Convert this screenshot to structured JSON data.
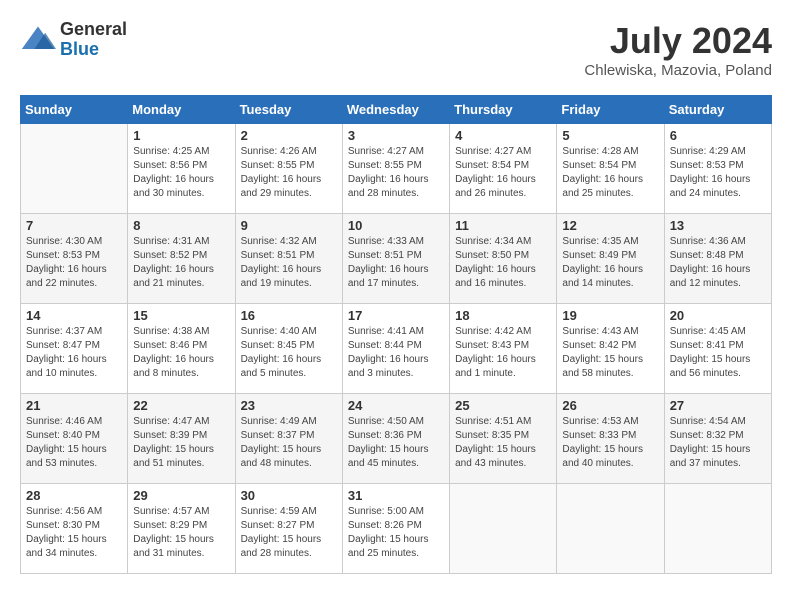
{
  "header": {
    "logo_general": "General",
    "logo_blue": "Blue",
    "month_year": "July 2024",
    "location": "Chlewiska, Mazovia, Poland"
  },
  "days_of_week": [
    "Sunday",
    "Monday",
    "Tuesday",
    "Wednesday",
    "Thursday",
    "Friday",
    "Saturday"
  ],
  "weeks": [
    [
      {
        "day": "",
        "sunrise": "",
        "sunset": "",
        "daylight": ""
      },
      {
        "day": "1",
        "sunrise": "4:25 AM",
        "sunset": "8:56 PM",
        "daylight": "16 hours and 30 minutes."
      },
      {
        "day": "2",
        "sunrise": "4:26 AM",
        "sunset": "8:55 PM",
        "daylight": "16 hours and 29 minutes."
      },
      {
        "day": "3",
        "sunrise": "4:27 AM",
        "sunset": "8:55 PM",
        "daylight": "16 hours and 28 minutes."
      },
      {
        "day": "4",
        "sunrise": "4:27 AM",
        "sunset": "8:54 PM",
        "daylight": "16 hours and 26 minutes."
      },
      {
        "day": "5",
        "sunrise": "4:28 AM",
        "sunset": "8:54 PM",
        "daylight": "16 hours and 25 minutes."
      },
      {
        "day": "6",
        "sunrise": "4:29 AM",
        "sunset": "8:53 PM",
        "daylight": "16 hours and 24 minutes."
      }
    ],
    [
      {
        "day": "7",
        "sunrise": "4:30 AM",
        "sunset": "8:53 PM",
        "daylight": "16 hours and 22 minutes."
      },
      {
        "day": "8",
        "sunrise": "4:31 AM",
        "sunset": "8:52 PM",
        "daylight": "16 hours and 21 minutes."
      },
      {
        "day": "9",
        "sunrise": "4:32 AM",
        "sunset": "8:51 PM",
        "daylight": "16 hours and 19 minutes."
      },
      {
        "day": "10",
        "sunrise": "4:33 AM",
        "sunset": "8:51 PM",
        "daylight": "16 hours and 17 minutes."
      },
      {
        "day": "11",
        "sunrise": "4:34 AM",
        "sunset": "8:50 PM",
        "daylight": "16 hours and 16 minutes."
      },
      {
        "day": "12",
        "sunrise": "4:35 AM",
        "sunset": "8:49 PM",
        "daylight": "16 hours and 14 minutes."
      },
      {
        "day": "13",
        "sunrise": "4:36 AM",
        "sunset": "8:48 PM",
        "daylight": "16 hours and 12 minutes."
      }
    ],
    [
      {
        "day": "14",
        "sunrise": "4:37 AM",
        "sunset": "8:47 PM",
        "daylight": "16 hours and 10 minutes."
      },
      {
        "day": "15",
        "sunrise": "4:38 AM",
        "sunset": "8:46 PM",
        "daylight": "16 hours and 8 minutes."
      },
      {
        "day": "16",
        "sunrise": "4:40 AM",
        "sunset": "8:45 PM",
        "daylight": "16 hours and 5 minutes."
      },
      {
        "day": "17",
        "sunrise": "4:41 AM",
        "sunset": "8:44 PM",
        "daylight": "16 hours and 3 minutes."
      },
      {
        "day": "18",
        "sunrise": "4:42 AM",
        "sunset": "8:43 PM",
        "daylight": "16 hours and 1 minute."
      },
      {
        "day": "19",
        "sunrise": "4:43 AM",
        "sunset": "8:42 PM",
        "daylight": "15 hours and 58 minutes."
      },
      {
        "day": "20",
        "sunrise": "4:45 AM",
        "sunset": "8:41 PM",
        "daylight": "15 hours and 56 minutes."
      }
    ],
    [
      {
        "day": "21",
        "sunrise": "4:46 AM",
        "sunset": "8:40 PM",
        "daylight": "15 hours and 53 minutes."
      },
      {
        "day": "22",
        "sunrise": "4:47 AM",
        "sunset": "8:39 PM",
        "daylight": "15 hours and 51 minutes."
      },
      {
        "day": "23",
        "sunrise": "4:49 AM",
        "sunset": "8:37 PM",
        "daylight": "15 hours and 48 minutes."
      },
      {
        "day": "24",
        "sunrise": "4:50 AM",
        "sunset": "8:36 PM",
        "daylight": "15 hours and 45 minutes."
      },
      {
        "day": "25",
        "sunrise": "4:51 AM",
        "sunset": "8:35 PM",
        "daylight": "15 hours and 43 minutes."
      },
      {
        "day": "26",
        "sunrise": "4:53 AM",
        "sunset": "8:33 PM",
        "daylight": "15 hours and 40 minutes."
      },
      {
        "day": "27",
        "sunrise": "4:54 AM",
        "sunset": "8:32 PM",
        "daylight": "15 hours and 37 minutes."
      }
    ],
    [
      {
        "day": "28",
        "sunrise": "4:56 AM",
        "sunset": "8:30 PM",
        "daylight": "15 hours and 34 minutes."
      },
      {
        "day": "29",
        "sunrise": "4:57 AM",
        "sunset": "8:29 PM",
        "daylight": "15 hours and 31 minutes."
      },
      {
        "day": "30",
        "sunrise": "4:59 AM",
        "sunset": "8:27 PM",
        "daylight": "15 hours and 28 minutes."
      },
      {
        "day": "31",
        "sunrise": "5:00 AM",
        "sunset": "8:26 PM",
        "daylight": "15 hours and 25 minutes."
      },
      {
        "day": "",
        "sunrise": "",
        "sunset": "",
        "daylight": ""
      },
      {
        "day": "",
        "sunrise": "",
        "sunset": "",
        "daylight": ""
      },
      {
        "day": "",
        "sunrise": "",
        "sunset": "",
        "daylight": ""
      }
    ]
  ],
  "labels": {
    "sunrise": "Sunrise:",
    "sunset": "Sunset:",
    "daylight": "Daylight:"
  }
}
